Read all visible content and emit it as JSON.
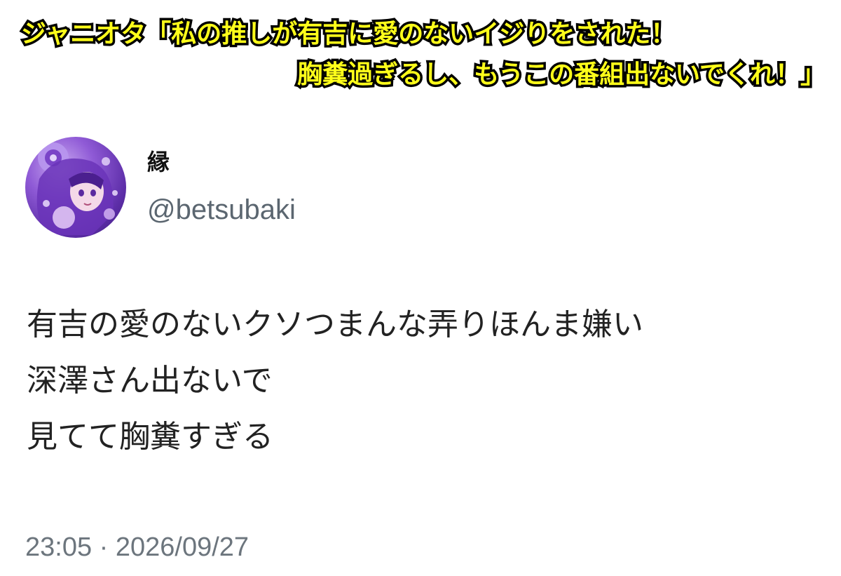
{
  "caption": {
    "line1": "ジャニオタ「私の推しが有吉に愛のないイジりをされた！",
    "line2": "胸糞過ぎるし、もうこの番組出ないでくれ！」"
  },
  "tweet": {
    "display_name": "縁",
    "handle": "@betsubaki",
    "avatar_icon": "anime-character-avatar-icon",
    "body_lines": [
      "有吉の愛のないクソつまんな弄りほんま嫌い",
      "深澤さん出ないで",
      "見てて胸糞すぎる"
    ],
    "timestamp": "23:05 · 2026/09/27"
  },
  "colors": {
    "caption_fill": "#ffff1a",
    "caption_stroke": "#000000",
    "handle": "#5b6670",
    "timestamp": "#6c757d"
  }
}
